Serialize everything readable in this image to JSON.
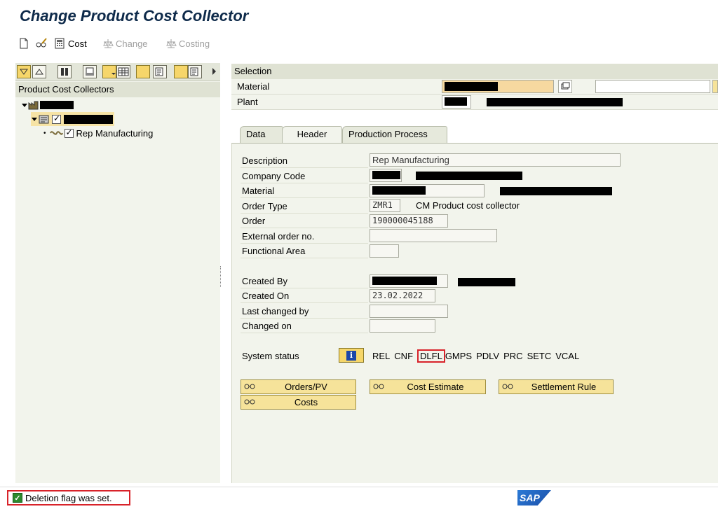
{
  "title": "Change Product Cost Collector",
  "toolbar": {
    "cost_label": "Cost",
    "change_label": "Change",
    "costing_label": "Costing"
  },
  "tree": {
    "header": "Product Cost Collectors",
    "leaf_label": "Rep Manufacturing"
  },
  "selection": {
    "header": "Selection",
    "material_label": "Material",
    "plant_label": "Plant"
  },
  "tabs": [
    "Data",
    "Header",
    "Production Process"
  ],
  "header_tab": {
    "description_label": "Description",
    "description_value": "Rep Manufacturing",
    "company_code_label": "Company Code",
    "material_label": "Material",
    "order_type_label": "Order Type",
    "order_type_value": "ZMR1",
    "order_type_text": "CM Product cost collector",
    "order_label": "Order",
    "order_value": "190000045188",
    "external_order_label": "External order no.",
    "functional_area_label": "Functional Area",
    "created_by_label": "Created By",
    "created_on_label": "Created On",
    "created_on_value": "23.02.2022",
    "last_changed_by_label": "Last changed by",
    "changed_on_label": "Changed on",
    "system_status_label": "System status",
    "status_codes": [
      "REL",
      "CNF",
      "DLFL",
      "GMPS",
      "PDLV",
      "PRC",
      "SETC",
      "VCAL"
    ]
  },
  "buttons": {
    "orders_pv": "Orders/PV",
    "cost_estimate": "Cost Estimate",
    "settlement_rule": "Settlement Rule",
    "costs": "Costs"
  },
  "status_bar": {
    "message": "Deletion flag was set.",
    "logo": "SAP"
  },
  "colors": {
    "accent": "#d8232a",
    "button": "#f6e39a",
    "panel": "#f2f4ec"
  }
}
